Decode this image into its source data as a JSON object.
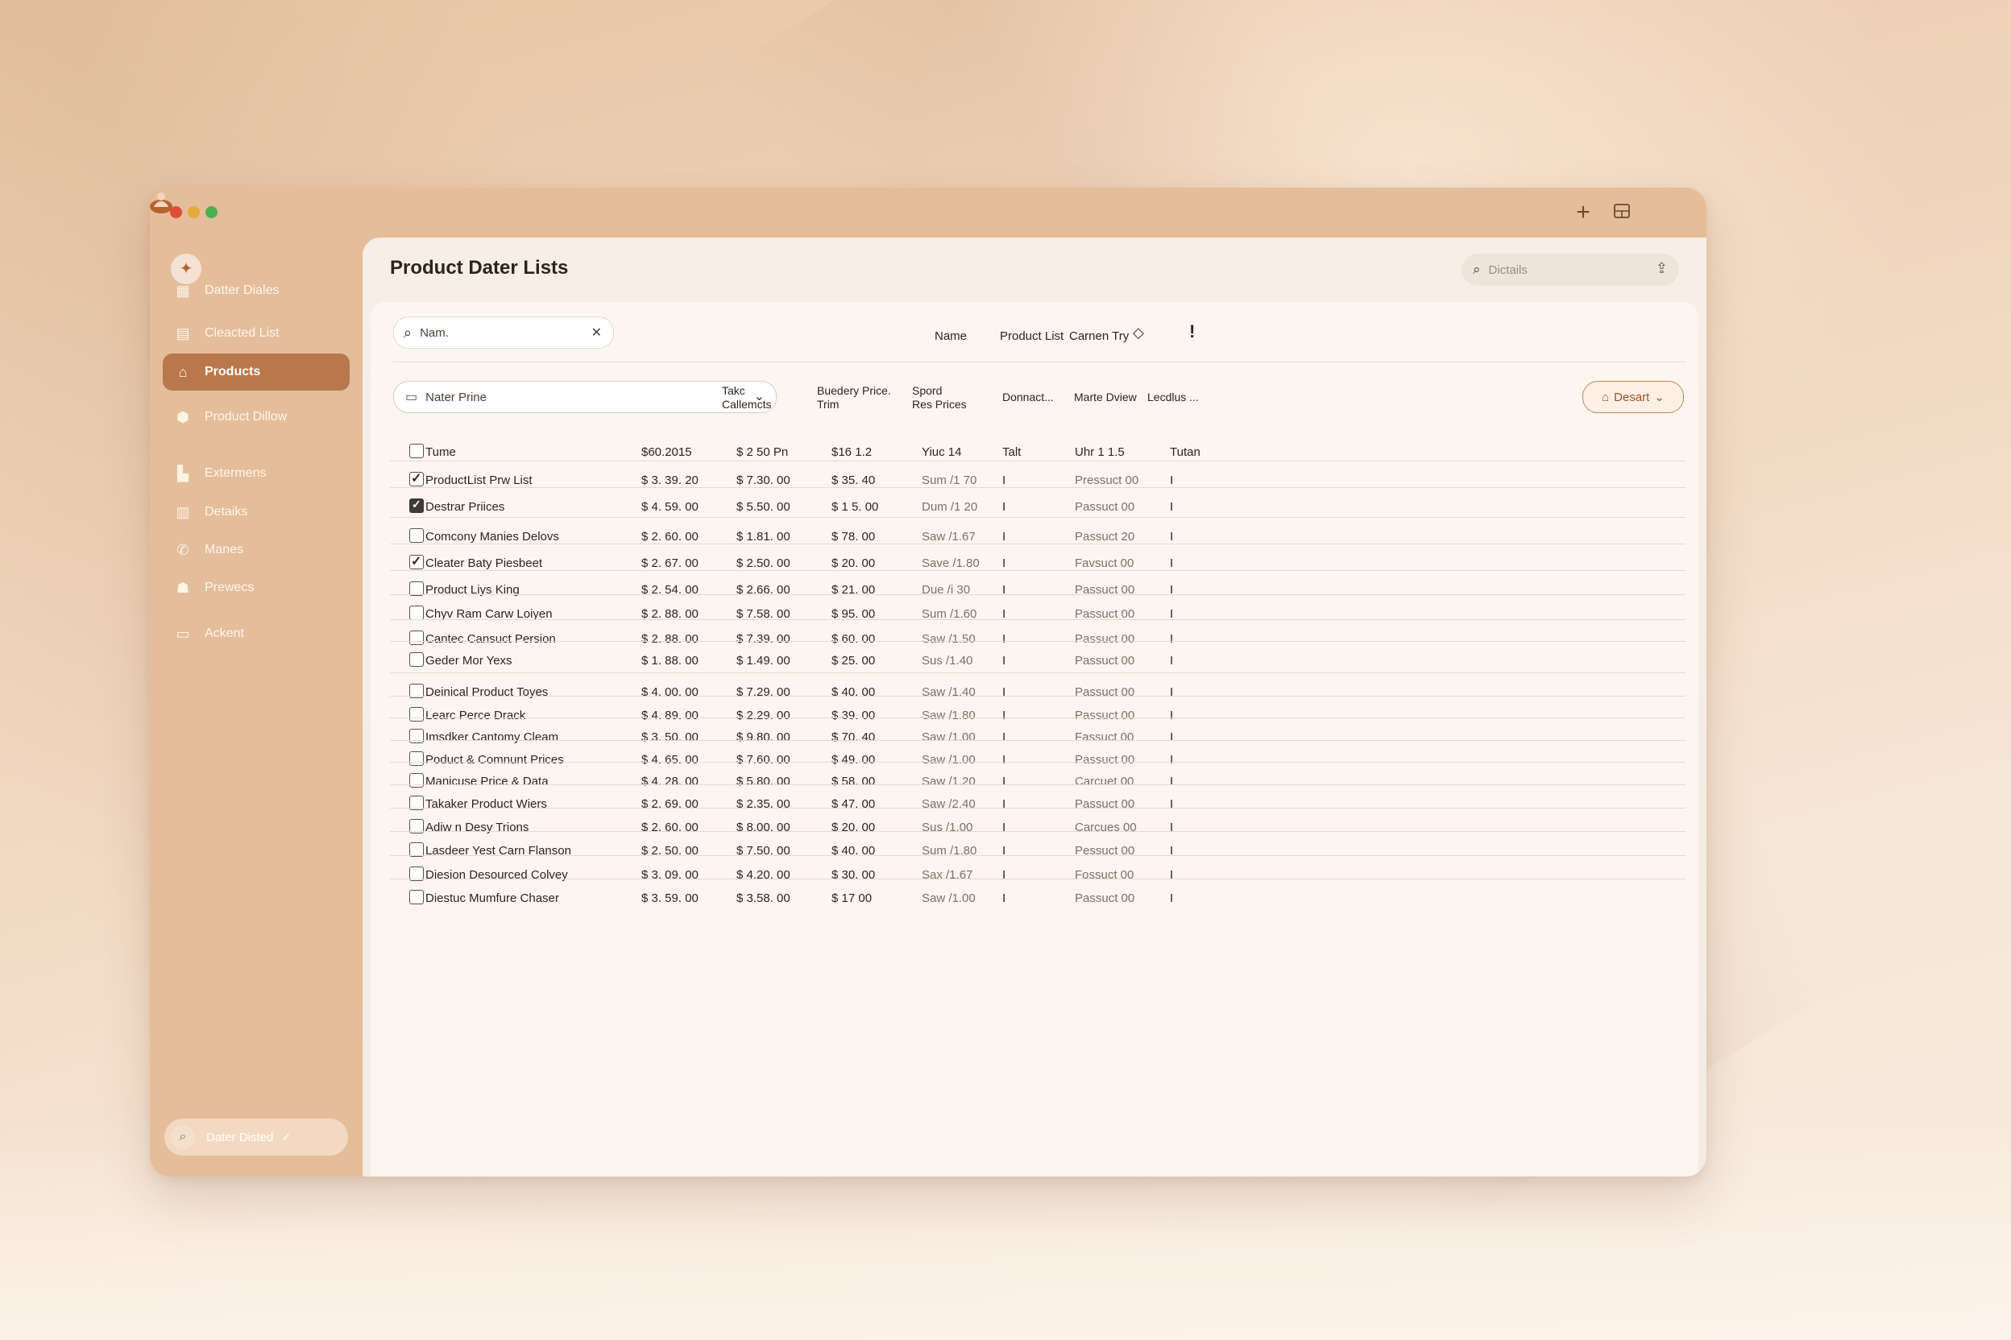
{
  "window": {
    "sidebar_search_label": "Dater Disted"
  },
  "sidebar": {
    "items": [
      {
        "label": "Datter Diales",
        "icon": "grid-icon"
      },
      {
        "label": "Cleacted List",
        "icon": "table-icon"
      },
      {
        "label": "Products",
        "icon": "home-icon",
        "active": true
      },
      {
        "label": "Product Dillow",
        "icon": "box-icon"
      },
      {
        "label": "Extermens",
        "icon": "building-icon"
      },
      {
        "label": "Detaiks",
        "icon": "chart-icon"
      },
      {
        "label": "Manes",
        "icon": "phone-icon"
      },
      {
        "label": "Prewecs",
        "icon": "users-icon"
      },
      {
        "label": "Ackent",
        "icon": "card-icon"
      }
    ]
  },
  "header": {
    "title": "Product Dater Lists",
    "search_placeholder": "Dictails"
  },
  "toolbar": {
    "name_search_value": "Nam.",
    "filter_select_value": "Nater Prine",
    "dessert_button": "Desart",
    "top_columns": [
      "Name",
      "Product List",
      "Carnen Try"
    ]
  },
  "table": {
    "columns": [
      {
        "line1": "Takc",
        "line2": "Callemcts"
      },
      {
        "line1": "Buedery Price.",
        "line2": "Trim"
      },
      {
        "line1": "Spord",
        "line2": "Res Prices"
      },
      {
        "line1": "Donnact...",
        "line2": ""
      },
      {
        "line1": "Marte Dview",
        "line2": ""
      },
      {
        "line1": "Lecdlus ...",
        "line2": ""
      }
    ],
    "summary_row": [
      "Tume",
      "$60.2015",
      "$ 2 50 Pn",
      "$16 1.2",
      "Yiuc 14",
      "Talt",
      "Uhr 1 1.5",
      "Tutan"
    ],
    "rows": [
      {
        "checked": "check",
        "name": "ProductList Prw List",
        "c1": "$ 3. 39. 20",
        "c2": "$ 7.30. 00",
        "c3": "$ 35. 40",
        "c4": "Sum /1 70",
        "c5": "I",
        "c6": "Pressuct 00",
        "c7": "I"
      },
      {
        "checked": "filled",
        "name": "Destrar Priices",
        "c1": "$ 4. 59. 00",
        "c2": "$ 5.50. 00",
        "c3": "$ 1 5. 00",
        "c4": "Dum /1 20",
        "c5": "I",
        "c6": "Passuct 00",
        "c7": "I"
      },
      {
        "checked": "none",
        "name": "Comcony Manies Delovs",
        "c1": "$ 2. 60. 00",
        "c2": "$ 1.81. 00",
        "c3": "$ 78. 00",
        "c4": "Saw /1.67",
        "c5": "I",
        "c6": "Passuct 20",
        "c7": "I"
      },
      {
        "checked": "check",
        "name": "Cleater Baty Piesbeet",
        "c1": "$ 2. 67. 00",
        "c2": "$ 2.50. 00",
        "c3": "$ 20. 00",
        "c4": "Save /1.80",
        "c5": "I",
        "c6": "Favsuct 00",
        "c7": "I"
      },
      {
        "checked": "none",
        "name": "Product Liys King",
        "c1": "$ 2. 54. 00",
        "c2": "$ 2.66. 00",
        "c3": "$ 21. 00",
        "c4": "Due /i 30",
        "c5": "I",
        "c6": "Passuct 00",
        "c7": "I"
      },
      {
        "checked": "none",
        "name": "Chyv Ram Carw Loiyen",
        "c1": "$ 2. 88. 00",
        "c2": "$ 7.58. 00",
        "c3": "$ 95. 00",
        "c4": "Sum /1.60",
        "c5": "I",
        "c6": "Passuct 00",
        "c7": "I"
      },
      {
        "checked": "none",
        "name": "Cantec Cansuct Persion",
        "c1": "$ 2. 88. 00",
        "c2": "$ 7.39. 00",
        "c3": "$ 60. 00",
        "c4": "Saw /1.50",
        "c5": "I",
        "c6": "Passuct 00",
        "c7": "I"
      },
      {
        "checked": "none",
        "name": "Geder Mor Yexs",
        "c1": "$ 1. 88. 00",
        "c2": "$ 1.49. 00",
        "c3": "$ 25. 00",
        "c4": "Sus /1.40",
        "c5": "I",
        "c6": "Passuct 00",
        "c7": "I"
      },
      {
        "checked": "none",
        "name": "Deinical Product Toyes",
        "c1": "$ 4. 00. 00",
        "c2": "$ 7.29. 00",
        "c3": "$ 40. 00",
        "c4": "Saw /1.40",
        "c5": "I",
        "c6": "Passuct 00",
        "c7": "I"
      },
      {
        "checked": "none",
        "name": "Learc Perce Drack",
        "c1": "$ 4. 89. 00",
        "c2": "$ 2.29. 00",
        "c3": "$ 39. 00",
        "c4": "Saw /1.80",
        "c5": "I",
        "c6": "Passuct 00",
        "c7": "I"
      },
      {
        "checked": "none",
        "name": "Imsdker Cantomy Cleam",
        "c1": "$ 3. 50. 00",
        "c2": "$ 9.80. 00",
        "c3": "$ 70. 40",
        "c4": "Saw /1.00",
        "c5": "I",
        "c6": "Fassuct 00",
        "c7": "I"
      },
      {
        "checked": "none",
        "name": "Poduct & Comnunt Prices",
        "c1": "$ 4. 65. 00",
        "c2": "$ 7.60. 00",
        "c3": "$ 49. 00",
        "c4": "Saw /1.00",
        "c5": "I",
        "c6": "Passuct 00",
        "c7": "I"
      },
      {
        "checked": "none",
        "name": "Manicuse Price & Data",
        "c1": "$ 4. 28. 00",
        "c2": "$ 5.80. 00",
        "c3": "$ 58. 00",
        "c4": "Saw /1.20",
        "c5": "I",
        "c6": "Carcuet 00",
        "c7": "I"
      },
      {
        "checked": "none",
        "name": "Takaker Product Wiers",
        "c1": "$ 2. 69. 00",
        "c2": "$ 2.35. 00",
        "c3": "$ 47. 00",
        "c4": "Saw /2.40",
        "c5": "I",
        "c6": "Passuct 00",
        "c7": "I"
      },
      {
        "checked": "none",
        "name": "Adiw n Desy Trions",
        "c1": "$ 2. 60. 00",
        "c2": "$ 8.00. 00",
        "c3": "$ 20. 00",
        "c4": "Sus /1.00",
        "c5": "I",
        "c6": "Carcues 00",
        "c7": "I"
      },
      {
        "checked": "none",
        "name": "Lasdeer Yest Carn Flanson",
        "c1": "$ 2. 50. 00",
        "c2": "$ 7.50. 00",
        "c3": "$ 40. 00",
        "c4": "Sum /1.80",
        "c5": "I",
        "c6": "Pessuct 00",
        "c7": "I"
      },
      {
        "checked": "none",
        "name": "Diesion Desourced Colvey",
        "c1": "$ 3. 09. 00",
        "c2": "$ 4.20. 00",
        "c3": "$ 30. 00",
        "c4": "Sax /1.67",
        "c5": "I",
        "c6": "Fossuct 00",
        "c7": "I"
      },
      {
        "checked": "none",
        "name": "Diestuc Mumfure Chaser",
        "c1": "$ 3. 59. 00",
        "c2": "$ 3.58. 00",
        "c3": "$ 17 00",
        "c4": "Saw /1.00",
        "c5": "I",
        "c6": "Passuct 00",
        "c7": "I"
      }
    ]
  }
}
